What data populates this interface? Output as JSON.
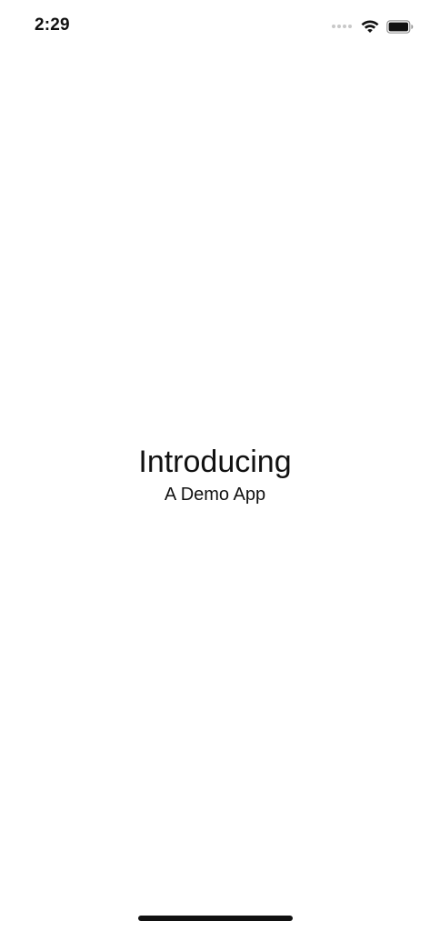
{
  "status_bar": {
    "time": "2:29",
    "icons": [
      "cellular-signal-icon",
      "wifi-icon",
      "battery-icon"
    ]
  },
  "main": {
    "title": "Introducing",
    "subtitle": "A Demo App"
  },
  "colors": {
    "background": "#ffffff",
    "text": "#111111",
    "inactive_signal": "#c8c8c8"
  }
}
